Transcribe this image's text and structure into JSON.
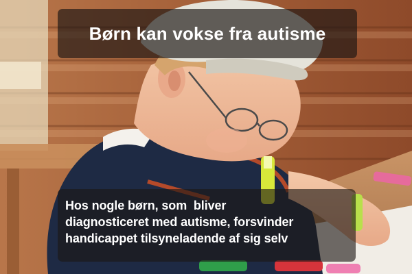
{
  "image": {
    "description_icon": "photo"
  },
  "title": "Børn kan vokse fra autisme",
  "caption": {
    "lines": [
      "Hos nogle børn, som  bliver",
      "diagnosticeret med autisme, forsvinder",
      "handicappet tilsyneladende af sig selv"
    ]
  }
}
